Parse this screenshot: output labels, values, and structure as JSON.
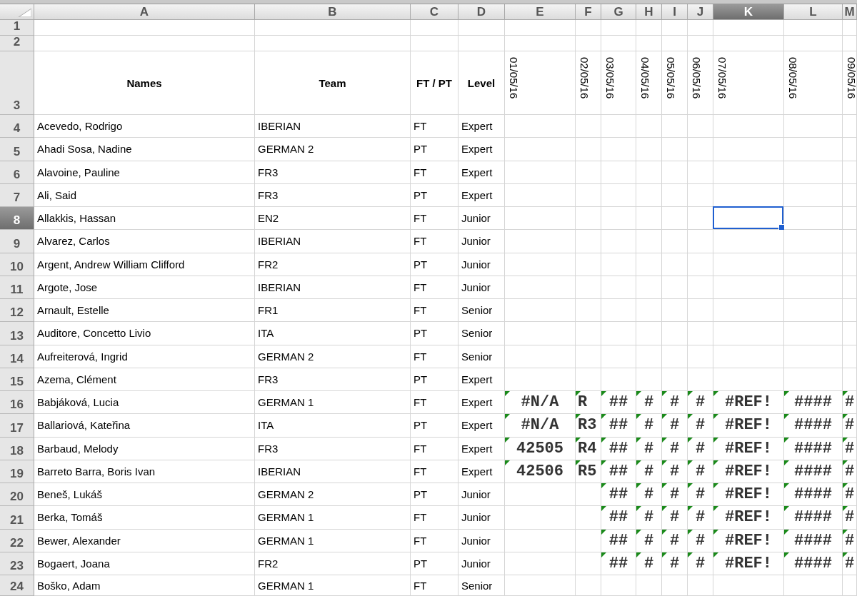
{
  "columns": [
    {
      "letter": "A",
      "selected": false
    },
    {
      "letter": "B",
      "selected": false
    },
    {
      "letter": "C",
      "selected": false
    },
    {
      "letter": "D",
      "selected": false
    },
    {
      "letter": "E",
      "selected": false
    },
    {
      "letter": "F",
      "selected": false
    },
    {
      "letter": "G",
      "selected": false
    },
    {
      "letter": "H",
      "selected": false
    },
    {
      "letter": "I",
      "selected": false
    },
    {
      "letter": "J",
      "selected": false
    },
    {
      "letter": "K",
      "selected": true
    },
    {
      "letter": "L",
      "selected": false
    },
    {
      "letter": "M",
      "selected": false
    }
  ],
  "rows": [
    {
      "number": "1",
      "kind": "blank",
      "selected": false
    },
    {
      "number": "2",
      "kind": "blank",
      "selected": false
    },
    {
      "number": "3",
      "kind": "heading",
      "selected": false,
      "cells": [
        "Names",
        "Team",
        "FT / PT",
        "Level"
      ],
      "dates": [
        "01/05/16",
        "02/05/16",
        "03/05/16",
        "04/05/16",
        "05/05/16",
        "06/05/16",
        "07/05/16",
        "08/05/16",
        "09/05/16"
      ]
    },
    {
      "number": "4",
      "kind": "data",
      "selected": false,
      "cells": [
        "Acevedo, Rodrigo",
        "IBERIAN",
        "FT",
        "Expert"
      ]
    },
    {
      "number": "5",
      "kind": "data",
      "selected": false,
      "cells": [
        "Ahadi Sosa, Nadine",
        "GERMAN 2",
        "PT",
        "Expert"
      ]
    },
    {
      "number": "6",
      "kind": "data",
      "selected": false,
      "cells": [
        "Alavoine, Pauline",
        "FR3",
        "FT",
        "Expert"
      ]
    },
    {
      "number": "7",
      "kind": "data",
      "selected": false,
      "cells": [
        "Ali, Said",
        "FR3",
        "PT",
        "Expert"
      ]
    },
    {
      "number": "8",
      "kind": "data",
      "selected": true,
      "cells": [
        "Allakkis, Hassan",
        "EN2",
        "FT",
        "Junior"
      ]
    },
    {
      "number": "9",
      "kind": "data",
      "selected": false,
      "cells": [
        "Alvarez, Carlos",
        "IBERIAN",
        "FT",
        "Junior"
      ]
    },
    {
      "number": "10",
      "kind": "data",
      "selected": false,
      "cells": [
        "Argent, Andrew William Clifford",
        "FR2",
        "PT",
        "Junior"
      ]
    },
    {
      "number": "11",
      "kind": "data",
      "selected": false,
      "cells": [
        "Argote, Jose",
        "IBERIAN",
        "FT",
        "Junior"
      ]
    },
    {
      "number": "12",
      "kind": "data",
      "selected": false,
      "cells": [
        "Arnault, Estelle",
        "FR1",
        "FT",
        "Senior"
      ]
    },
    {
      "number": "13",
      "kind": "data",
      "selected": false,
      "cells": [
        "Auditore, Concetto Livio",
        "ITA",
        "PT",
        "Senior"
      ]
    },
    {
      "number": "14",
      "kind": "data",
      "selected": false,
      "cells": [
        "Aufreiterová, Ingrid",
        "GERMAN 2",
        "FT",
        "Senior"
      ]
    },
    {
      "number": "15",
      "kind": "data",
      "selected": false,
      "cells": [
        "Azema, Clément",
        "FR3",
        "PT",
        "Expert"
      ]
    },
    {
      "number": "16",
      "kind": "data",
      "selected": false,
      "cells": [
        "Babjáková, Lucia",
        "GERMAN 1",
        "FT",
        "Expert"
      ],
      "values": [
        {
          "text": "#N/A",
          "flagged": true
        },
        {
          "text": "R",
          "flagged": true
        },
        {
          "text": "##",
          "flagged": true
        },
        {
          "text": "#",
          "flagged": true
        },
        {
          "text": "#",
          "flagged": true
        },
        {
          "text": "#",
          "flagged": true
        },
        {
          "text": "#REF!",
          "flagged": true
        },
        {
          "text": "####",
          "flagged": true
        },
        {
          "text": "#",
          "flagged": true
        }
      ]
    },
    {
      "number": "17",
      "kind": "data",
      "selected": false,
      "cells": [
        "Ballariová, Kateřina",
        "ITA",
        "PT",
        "Expert"
      ],
      "values": [
        {
          "text": "#N/A",
          "flagged": true
        },
        {
          "text": "R3",
          "flagged": true
        },
        {
          "text": "##",
          "flagged": true
        },
        {
          "text": "#",
          "flagged": true
        },
        {
          "text": "#",
          "flagged": true
        },
        {
          "text": "#",
          "flagged": true
        },
        {
          "text": "#REF!",
          "flagged": true
        },
        {
          "text": "####",
          "flagged": true
        },
        {
          "text": "#",
          "flagged": true
        }
      ]
    },
    {
      "number": "18",
      "kind": "data",
      "selected": false,
      "cells": [
        "Barbaud, Melody",
        "FR3",
        "FT",
        "Expert"
      ],
      "values": [
        {
          "text": "42505",
          "flagged": true
        },
        {
          "text": "R4",
          "flagged": true
        },
        {
          "text": "##",
          "flagged": true
        },
        {
          "text": "#",
          "flagged": true
        },
        {
          "text": "#",
          "flagged": true
        },
        {
          "text": "#",
          "flagged": true
        },
        {
          "text": "#REF!",
          "flagged": true
        },
        {
          "text": "####",
          "flagged": true
        },
        {
          "text": "#",
          "flagged": true
        }
      ]
    },
    {
      "number": "19",
      "kind": "data",
      "selected": false,
      "cells": [
        "Barreto Barra, Boris Ivan",
        "IBERIAN",
        "FT",
        "Expert"
      ],
      "values": [
        {
          "text": "42506",
          "flagged": true
        },
        {
          "text": "R5",
          "flagged": true
        },
        {
          "text": "##",
          "flagged": true
        },
        {
          "text": "#",
          "flagged": true
        },
        {
          "text": "#",
          "flagged": true
        },
        {
          "text": "#",
          "flagged": true
        },
        {
          "text": "#REF!",
          "flagged": true
        },
        {
          "text": "####",
          "flagged": true
        },
        {
          "text": "#",
          "flagged": true
        }
      ]
    },
    {
      "number": "20",
      "kind": "data",
      "selected": false,
      "cells": [
        "Beneš, Lukáš",
        "GERMAN 2",
        "PT",
        "Junior"
      ],
      "values": [
        {
          "flagged": false
        },
        {
          "flagged": false
        },
        {
          "text": "##",
          "flagged": true
        },
        {
          "text": "#",
          "flagged": true
        },
        {
          "text": "#",
          "flagged": true
        },
        {
          "text": "#",
          "flagged": true
        },
        {
          "text": "#REF!",
          "flagged": true
        },
        {
          "text": "####",
          "flagged": true
        },
        {
          "text": "#",
          "flagged": true
        }
      ]
    },
    {
      "number": "21",
      "kind": "data",
      "selected": false,
      "cells": [
        "Berka, Tomáš",
        "GERMAN 1",
        "FT",
        "Junior"
      ],
      "values": [
        {
          "flagged": false
        },
        {
          "flagged": false
        },
        {
          "text": "##",
          "flagged": true
        },
        {
          "text": "#",
          "flagged": true
        },
        {
          "text": "#",
          "flagged": true
        },
        {
          "text": "#",
          "flagged": true
        },
        {
          "text": "#REF!",
          "flagged": true
        },
        {
          "text": "####",
          "flagged": true
        },
        {
          "text": "#",
          "flagged": true
        }
      ]
    },
    {
      "number": "22",
      "kind": "data",
      "selected": false,
      "cells": [
        "Bewer, Alexander",
        "GERMAN 1",
        "FT",
        "Junior"
      ],
      "values": [
        {
          "flagged": false
        },
        {
          "flagged": false
        },
        {
          "text": "##",
          "flagged": true
        },
        {
          "text": "#",
          "flagged": true
        },
        {
          "text": "#",
          "flagged": true
        },
        {
          "text": "#",
          "flagged": true
        },
        {
          "text": "#REF!",
          "flagged": true
        },
        {
          "text": "####",
          "flagged": true
        },
        {
          "text": "#",
          "flagged": true
        }
      ]
    },
    {
      "number": "23",
      "kind": "data",
      "selected": false,
      "cells": [
        "Bogaert, Joana",
        "FR2",
        "PT",
        "Junior"
      ],
      "values": [
        {
          "flagged": false
        },
        {
          "flagged": false
        },
        {
          "text": "##",
          "flagged": true
        },
        {
          "text": "#",
          "flagged": true
        },
        {
          "text": "#",
          "flagged": true
        },
        {
          "text": "#",
          "flagged": true
        },
        {
          "text": "#REF!",
          "flagged": true
        },
        {
          "text": "####",
          "flagged": true
        },
        {
          "text": "#",
          "flagged": true
        }
      ]
    },
    {
      "number": "24",
      "kind": "data",
      "selected": false,
      "cells": [
        "Boško, Adam",
        "GERMAN 1",
        "FT",
        "Senior"
      ]
    }
  ]
}
